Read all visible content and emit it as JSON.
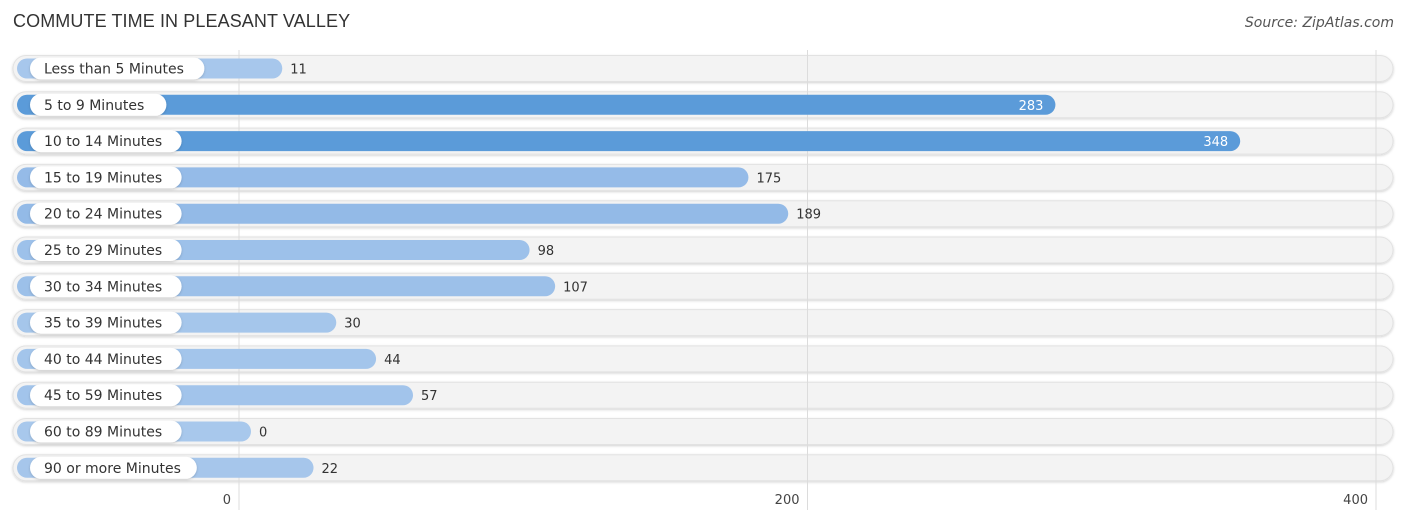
{
  "chart_data": {
    "type": "bar",
    "orientation": "horizontal",
    "title": "COMMUTE TIME IN PLEASANT VALLEY",
    "source": "Source: ZipAtlas.com",
    "categories": [
      "Less than 5 Minutes",
      "5 to 9 Minutes",
      "10 to 14 Minutes",
      "15 to 19 Minutes",
      "20 to 24 Minutes",
      "25 to 29 Minutes",
      "30 to 34 Minutes",
      "35 to 39 Minutes",
      "40 to 44 Minutes",
      "45 to 59 Minutes",
      "60 to 89 Minutes",
      "90 or more Minutes"
    ],
    "values": [
      11,
      283,
      348,
      175,
      189,
      98,
      107,
      30,
      44,
      57,
      0,
      22
    ],
    "xlabel": "",
    "ylabel": "",
    "xlim": [
      0,
      400
    ],
    "xticks": [
      0,
      200,
      400
    ],
    "grid": true,
    "legend": "none",
    "colors": {
      "bar_light": "#a8c8ec",
      "bar_dark": "#5b9bd9",
      "track": "#f2f2f2",
      "value_inside": "#ffffff",
      "value_outside": "#333333"
    }
  }
}
